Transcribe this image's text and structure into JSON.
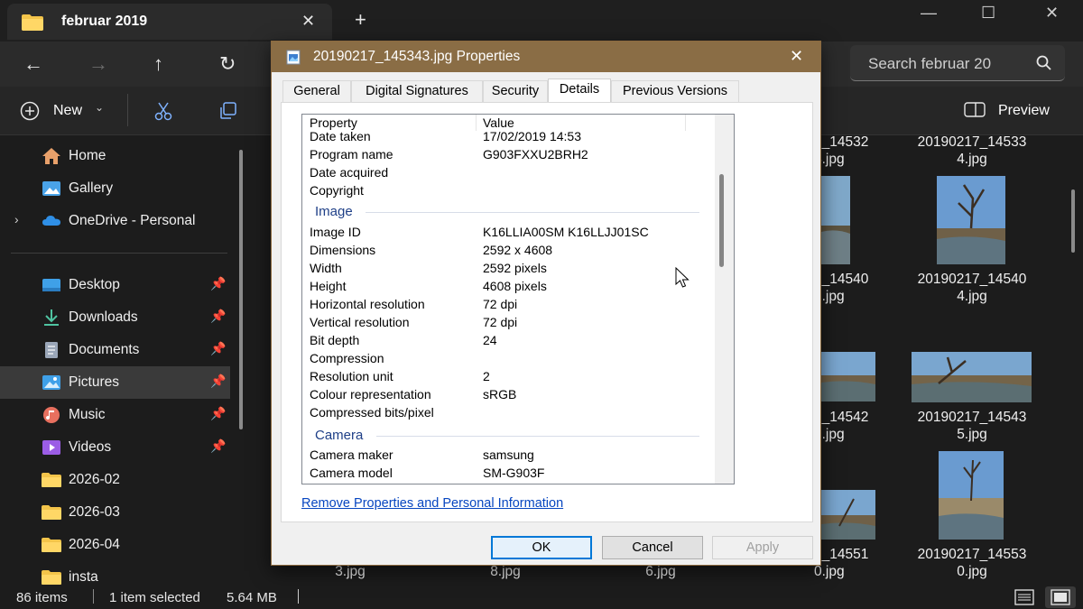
{
  "explorer": {
    "tab_title": "februar 2019",
    "search_placeholder": "Search februar 20",
    "toolbar": {
      "new_label": "New",
      "preview_label": "Preview"
    },
    "sidebar": [
      {
        "label": "Home",
        "icon": "home-icon",
        "pinned": false
      },
      {
        "label": "Gallery",
        "icon": "gallery-icon",
        "pinned": false
      },
      {
        "label": "OneDrive - Personal",
        "icon": "onedrive-icon",
        "pinned": false
      },
      {
        "label": "Desktop",
        "icon": "desktop-icon",
        "pinned": true
      },
      {
        "label": "Downloads",
        "icon": "downloads-icon",
        "pinned": true
      },
      {
        "label": "Documents",
        "icon": "documents-icon",
        "pinned": true
      },
      {
        "label": "Pictures",
        "icon": "pictures-icon",
        "pinned": true,
        "selected": true
      },
      {
        "label": "Music",
        "icon": "music-icon",
        "pinned": true
      },
      {
        "label": "Videos",
        "icon": "videos-icon",
        "pinned": true
      },
      {
        "label": "2026-02",
        "icon": "folder-icon",
        "pinned": false
      },
      {
        "label": "2026-03",
        "icon": "folder-icon",
        "pinned": false
      },
      {
        "label": "2026-04",
        "icon": "folder-icon",
        "pinned": false
      },
      {
        "label": "insta",
        "icon": "folder-icon",
        "pinned": false
      }
    ],
    "files": {
      "row1": [
        "7_14532",
        "4.jpg",
        "20190217_14533",
        "4.jpg"
      ],
      "row2": [
        "7_14540",
        "9.jpg",
        "20190217_14540",
        "4.jpg"
      ],
      "row3": [
        "7_14542",
        "9.jpg",
        "20190217_14543",
        "5.jpg"
      ],
      "row4": [
        "7_14551",
        "0.jpg",
        "20190217_14553",
        "0.jpg"
      ],
      "row4_left": [
        "3.jpg",
        "8.jpg",
        "6.jpg"
      ]
    },
    "status": {
      "items": "86 items",
      "selected": "1 item selected",
      "size": "5.64 MB"
    }
  },
  "dialog": {
    "title": "20190217_145343.jpg Properties",
    "tabs": [
      "General",
      "Digital Signatures",
      "Security",
      "Details",
      "Previous Versions"
    ],
    "active_tab": "Details",
    "columns": {
      "property": "Property",
      "value": "Value"
    },
    "origin_rows": [
      {
        "p": "Date taken",
        "v": "17/02/2019 14:53"
      },
      {
        "p": "Program name",
        "v": "G903FXXU2BRH2"
      },
      {
        "p": "Date acquired",
        "v": ""
      },
      {
        "p": "Copyright",
        "v": ""
      }
    ],
    "image_section": "Image",
    "image_rows": [
      {
        "p": "Image ID",
        "v": "K16LLIA00SM K16LLJJ01SC"
      },
      {
        "p": "Dimensions",
        "v": "2592 x 4608"
      },
      {
        "p": "Width",
        "v": "2592 pixels"
      },
      {
        "p": "Height",
        "v": "4608 pixels"
      },
      {
        "p": "Horizontal resolution",
        "v": "72 dpi"
      },
      {
        "p": "Vertical resolution",
        "v": "72 dpi"
      },
      {
        "p": "Bit depth",
        "v": "24"
      },
      {
        "p": "Compression",
        "v": ""
      },
      {
        "p": "Resolution unit",
        "v": "2"
      },
      {
        "p": "Colour representation",
        "v": "sRGB"
      },
      {
        "p": "Compressed bits/pixel",
        "v": ""
      }
    ],
    "camera_section": "Camera",
    "camera_rows": [
      {
        "p": "Camera maker",
        "v": "samsung"
      },
      {
        "p": "Camera model",
        "v": "SM-G903F"
      }
    ],
    "remove_link": "Remove Properties and Personal Information",
    "buttons": {
      "ok": "OK",
      "cancel": "Cancel",
      "apply": "Apply"
    }
  }
}
